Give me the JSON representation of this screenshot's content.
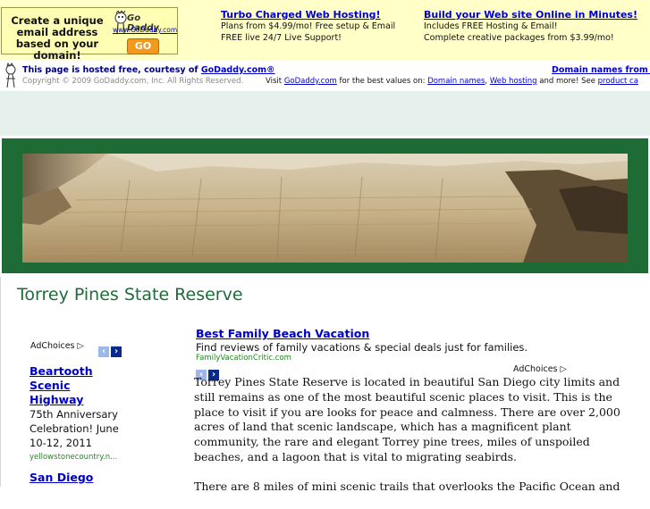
{
  "top_ad": {
    "text": "Create a unique email address based on your domain!",
    "brand": "Go Daddy",
    "url": "www.GoDaddy.com",
    "go_label": "GO"
  },
  "promos": [
    {
      "heading": "Turbo Charged Web Hosting!",
      "line1": "Plans from $4.99/mo! Free setup & Email",
      "line2": "FREE live 24/7 Live Support!"
    },
    {
      "heading": "Build your Web site Online in Minutes!",
      "line1": "Includes FREE Hosting & Email!",
      "line2": "Complete creative packages from $3.99/mo!"
    }
  ],
  "hosted": {
    "prefix": "This page is hosted free, courtesy of ",
    "link": "GoDaddy.com®",
    "right_link": "Domain names from $",
    "copyright": "Copyright © 2009 GoDaddy.com, Inc. All Rights Reserved.",
    "visit_prefix": "Visit ",
    "visit_link": "GoDaddy.com",
    "visit_mid": " for the best values on: ",
    "link_domains": "Domain names",
    "sep": ", ",
    "link_hosting": "Web hosting",
    "more": " and more! See ",
    "link_product": "product ca"
  },
  "page_title": "Torrey Pines State Reserve",
  "adchoices_label": "AdChoices",
  "side_ads": [
    {
      "title": "Beartooth Scenic Highway",
      "desc": "75th Anniversary Celebration! June 10-12, 2011",
      "url": "yellowstonecountry.n..."
    },
    {
      "title": "San Diego",
      "desc": "",
      "url": ""
    }
  ],
  "main_ad": {
    "title": "Best Family Beach Vacation",
    "desc": "Find reviews of family vacations & special deals just for families.",
    "url": "FamilyVacationCritic.com"
  },
  "article": {
    "para1": "Torrey Pines State Reserve is located in beautiful San Diego city limits and still remains as one of the most beautiful scenic places to visit.  This is the place to visit if you are looks for peace and calmness.  There are over 2,000 acres of land that scenic landscape, which has a magnificent plant community, the rare and elegant Torrey pine trees, miles of unspoiled beaches, and a lagoon that is vital to migrating seabirds.",
    "para2": "There are 8 miles of mini scenic trails that overlooks the Pacific Ocean and"
  },
  "colors": {
    "accent_green": "#1e6b35",
    "link_blue": "#0000cc",
    "ad_bg": "#ffffc8"
  }
}
